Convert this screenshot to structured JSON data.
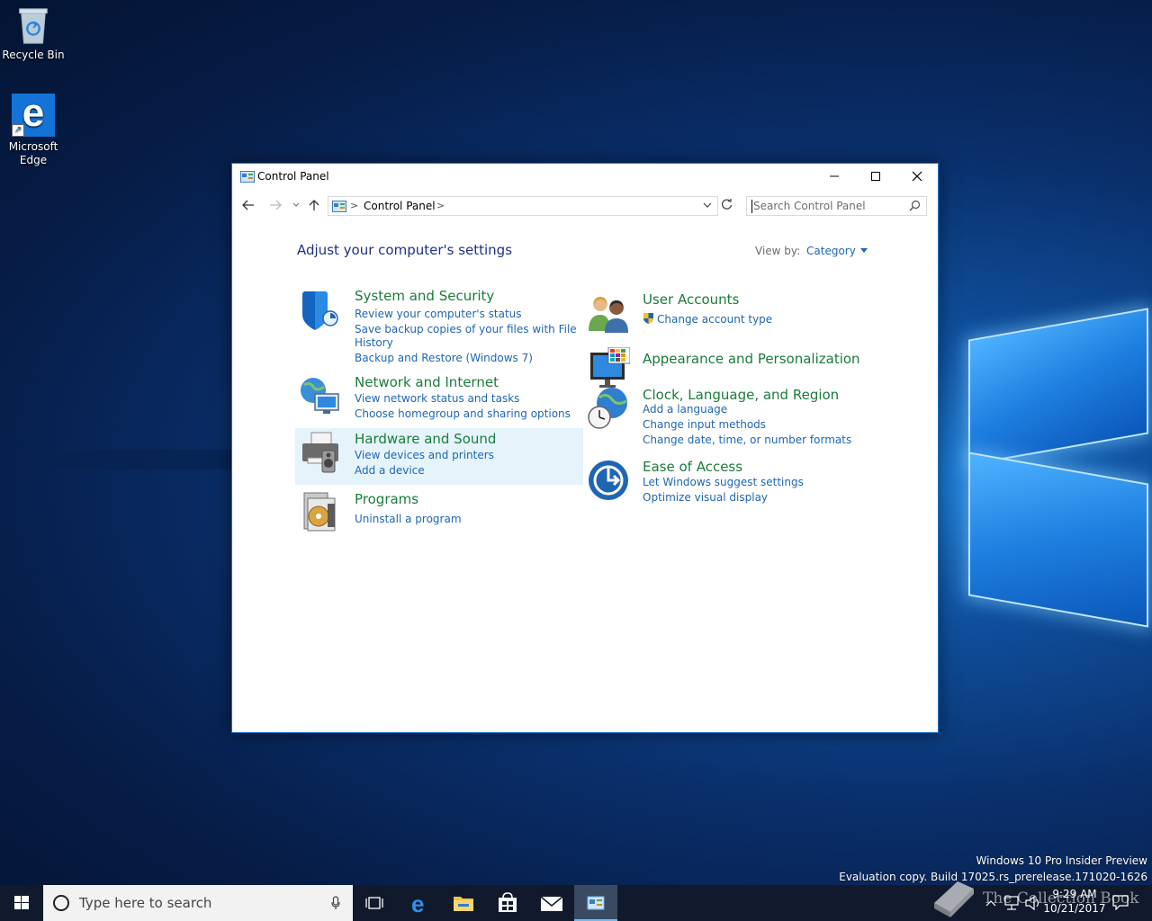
{
  "desktop": {
    "icons": [
      {
        "label": "Recycle Bin"
      },
      {
        "label": "Microsoft Edge"
      }
    ],
    "watermark_line1": "Windows 10 Pro Insider Preview",
    "watermark_line2": "Evaluation copy. Build 17025.rs_prerelease.171020-1626",
    "watermark_logo_text": "The Collection Book"
  },
  "window": {
    "title": "Control Panel",
    "address": {
      "crumb": "Control Panel",
      "separator": ">"
    },
    "search": {
      "placeholder": "Search Control Panel"
    },
    "heading": "Adjust your computer's settings",
    "view_by": {
      "label": "View by:",
      "value": "Category"
    },
    "categories": [
      {
        "title": "System and Security",
        "icon": "shield-icon",
        "links": [
          "Review your computer's status",
          "Save backup copies of your files with File",
          "History",
          "Backup and Restore (Windows 7)"
        ]
      },
      {
        "title": "Network and Internet",
        "icon": "network-globe-icon",
        "links": [
          "View network status and tasks",
          "Choose homegroup and sharing options"
        ]
      },
      {
        "title": "Hardware and Sound",
        "icon": "printer-speaker-icon",
        "links": [
          "View devices and printers",
          "Add a device"
        ]
      },
      {
        "title": "Programs",
        "icon": "programs-disc-icon",
        "links": [
          "Uninstall a program"
        ]
      },
      {
        "title": "User Accounts",
        "icon": "users-icon",
        "links": [
          "Change account type"
        ]
      },
      {
        "title": "Appearance and Personalization",
        "icon": "monitor-palette-icon",
        "links": []
      },
      {
        "title": "Clock, Language, and Region",
        "icon": "clock-globe-icon",
        "links": [
          "Add a language",
          "Change input methods",
          "Change date, time, or number formats"
        ]
      },
      {
        "title": "Ease of Access",
        "icon": "ease-of-access-icon",
        "links": [
          "Let Windows suggest settings",
          "Optimize visual display"
        ]
      }
    ]
  },
  "taskbar": {
    "search_placeholder": "Type here to search",
    "pinned": [
      "task-view-icon",
      "edge-icon",
      "file-explorer-icon",
      "store-icon",
      "mail-icon",
      "control-panel-icon"
    ],
    "time": "9:29 AM",
    "date": "10/21/2017"
  },
  "colors": {
    "category_title": "#1b7c3a",
    "link": "#1e66b4",
    "heading": "#1e3287",
    "hover_bg": "#e5f3fb",
    "taskbar": "#101a2c"
  }
}
